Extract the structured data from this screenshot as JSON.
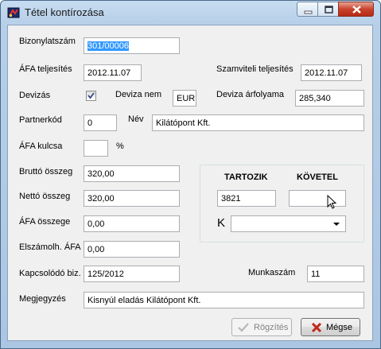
{
  "window": {
    "title": "Tétel kontírozása"
  },
  "form": {
    "bizonylatszam": {
      "label": "Bizonylatszám",
      "value": "301/00006"
    },
    "afa_teljesites": {
      "label": "ÁFA teljesítés",
      "value": "2012.11.07"
    },
    "szamviteli_teljesites": {
      "label": "Szamviteli teljesítés",
      "value": "2012.11.07"
    },
    "devizas": {
      "label": "Devizás",
      "checked": true
    },
    "deviza_nem": {
      "label": "Deviza nem",
      "value": "EUR"
    },
    "deviza_arfolyama": {
      "label": "Deviza árfolyama",
      "value": "285,340"
    },
    "partnerkod": {
      "label": "Partnerkód",
      "value": "0"
    },
    "nev": {
      "label": "Név",
      "value": "Kilátópont Kft."
    },
    "afa_kulcsa": {
      "label": "ÁFA kulcsa",
      "value": "",
      "unit": "%"
    },
    "brutto": {
      "label": "Bruttó összeg",
      "value": "320,00"
    },
    "netto": {
      "label": "Nettó összeg",
      "value": "320,00"
    },
    "afa_osszege": {
      "label": "ÁFA összege",
      "value": "0,00"
    },
    "elszamolh_afa": {
      "label": "Elszámolh. ÁFA",
      "value": "0,00"
    },
    "kapcsolodo": {
      "label": "Kapcsolódó biz.",
      "value": "125/2012"
    },
    "munkaszam": {
      "label": "Munkaszám",
      "value": "11"
    },
    "megjegyzes": {
      "label": "Megjegyzés",
      "value": "Kisnyúl eladás Kilátópont Kft."
    }
  },
  "accounting": {
    "tartozik_label": "TARTOZIK",
    "kovetel_label": "KÖVETEL",
    "tartozik_value": "3821",
    "kovetel_value": "",
    "k_label": "K",
    "k_value": ""
  },
  "buttons": {
    "save_label": "Rögzítés",
    "cancel_label": "Mégse"
  },
  "colors": {
    "selection": "#3399ff",
    "close_red": "#c9432c"
  }
}
